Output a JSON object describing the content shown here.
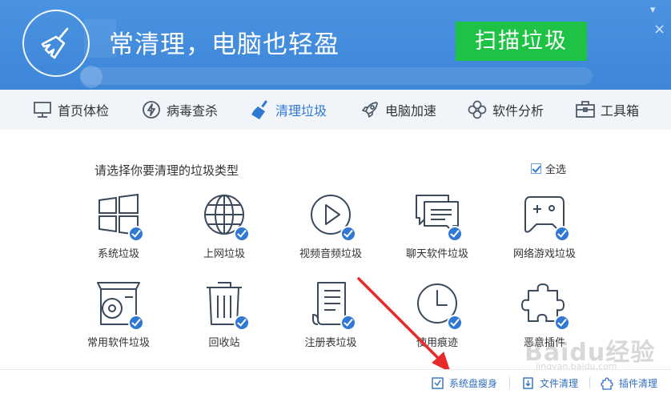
{
  "theme": {
    "header_blue": "#4a93e2",
    "nav_bg": "#f1f4f9",
    "accent_blue": "#2f78d4",
    "scan_green": "#1ec244",
    "annotation_red": "#e62b2b"
  },
  "header": {
    "slogan": "常清理，电脑也轻盈",
    "scan_button": "扫描垃圾",
    "logo_icon": "broom-icon"
  },
  "nav": {
    "items": [
      {
        "label": "首页体检",
        "icon": "monitor-icon",
        "active": false
      },
      {
        "label": "病毒查杀",
        "icon": "lightning-shield-icon",
        "active": false
      },
      {
        "label": "清理垃圾",
        "icon": "broom-icon",
        "active": true
      },
      {
        "label": "电脑加速",
        "icon": "rocket-icon",
        "active": false
      },
      {
        "label": "软件分析",
        "icon": "flower-icon",
        "active": false
      },
      {
        "label": "工具箱",
        "icon": "toolbox-icon",
        "active": false
      }
    ]
  },
  "main": {
    "prompt": "请选择你要清理的垃圾类型",
    "select_all": "全选",
    "select_all_checked": true,
    "tiles": [
      {
        "label": "系统垃圾",
        "icon": "windows-icon",
        "checked": true
      },
      {
        "label": "上网垃圾",
        "icon": "globe-icon",
        "checked": true
      },
      {
        "label": "视频音频垃圾",
        "icon": "play-icon",
        "checked": true
      },
      {
        "label": "聊天软件垃圾",
        "icon": "chat-icon",
        "checked": true
      },
      {
        "label": "网络游戏垃圾",
        "icon": "gamepad-icon",
        "checked": true
      },
      {
        "label": "常用软件垃圾",
        "icon": "disc-box-icon",
        "checked": true
      },
      {
        "label": "回收站",
        "icon": "trash-icon",
        "checked": true
      },
      {
        "label": "注册表垃圾",
        "icon": "scroll-icon",
        "checked": true
      },
      {
        "label": "使用痕迹",
        "icon": "clock-icon",
        "checked": true
      },
      {
        "label": "恶意插件",
        "icon": "puzzle-icon",
        "checked": true
      }
    ]
  },
  "footer": {
    "links": [
      {
        "label": "系统盘瘦身",
        "icon": "disk-check-icon"
      },
      {
        "label": "文件清理",
        "icon": "file-download-icon"
      },
      {
        "label": "插件清理",
        "icon": "puzzle-small-icon"
      }
    ]
  },
  "watermark": {
    "text": "Baidu经验",
    "url": "jingyan.baidu.com"
  }
}
